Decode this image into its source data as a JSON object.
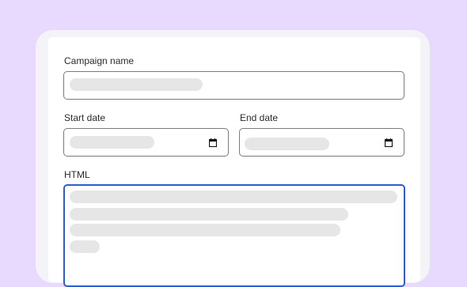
{
  "form": {
    "campaign_name_label": "Campaign name",
    "start_date_label": "Start date",
    "end_date_label": "End date",
    "html_label": "HTML"
  },
  "icons": {
    "start_date": "calendar-icon",
    "end_date": "calendar-icon"
  },
  "colors": {
    "background": "#e8dafe",
    "focus_border": "#2b5fd0",
    "placeholder_skeleton": "#e6e6e6"
  }
}
